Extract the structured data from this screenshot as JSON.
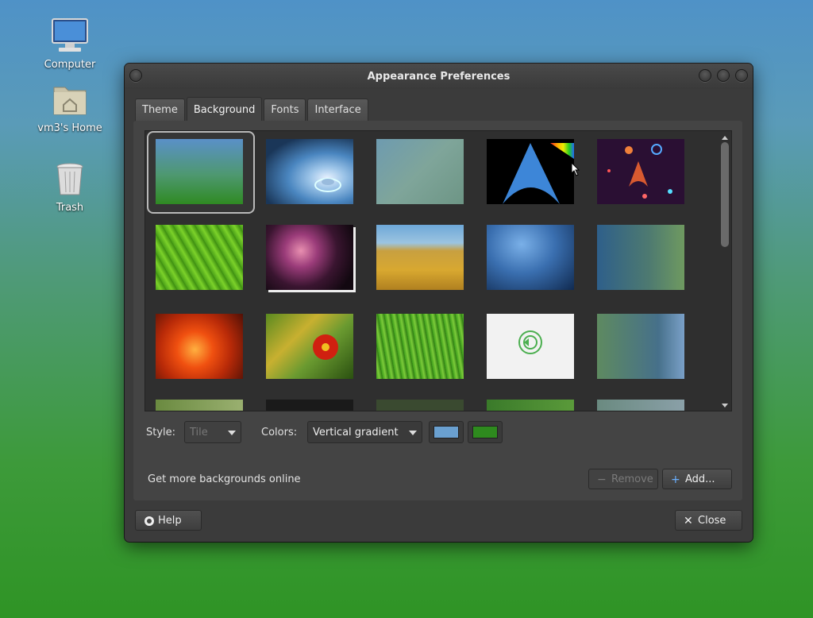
{
  "desktop": {
    "icons": [
      {
        "label": "Computer"
      },
      {
        "label": "vm3's Home"
      },
      {
        "label": "Trash"
      }
    ]
  },
  "window": {
    "title": "Appearance Preferences"
  },
  "tabs": [
    {
      "label": "Theme"
    },
    {
      "label": "Background"
    },
    {
      "label": "Fonts"
    },
    {
      "label": "Interface"
    }
  ],
  "active_tab": "Background",
  "background": {
    "style_label": "Style:",
    "style_value": "Tile",
    "colors_label": "Colors:",
    "colors_value": "Vertical gradient",
    "color1": "#6aa0d0",
    "color2": "#2e8a1e",
    "link_text": "Get more backgrounds online",
    "remove_label": "Remove",
    "add_label": "Add..."
  },
  "footer": {
    "help_label": "Help",
    "close_label": "Close"
  }
}
